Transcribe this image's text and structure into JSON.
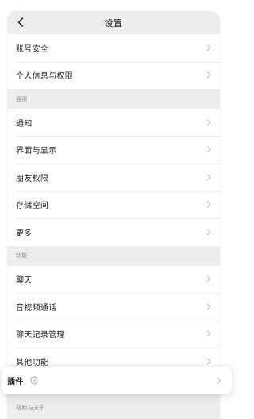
{
  "header": {
    "title": "设置",
    "back_icon": "chevron-left-icon"
  },
  "account_group": {
    "items": [
      {
        "label": "账号安全"
      },
      {
        "label": "个人信息与权限"
      }
    ]
  },
  "general_group": {
    "heading": "通用",
    "items": [
      {
        "label": "通知"
      },
      {
        "label": "界面与显示"
      },
      {
        "label": "朋友权限"
      },
      {
        "label": "存储空间"
      },
      {
        "label": "更多"
      }
    ]
  },
  "features_group": {
    "heading": "功能",
    "items": [
      {
        "label": "聊天"
      },
      {
        "label": "音视频通话"
      },
      {
        "label": "聊天记录管理"
      },
      {
        "label": "其他功能"
      }
    ]
  },
  "plugins_card": {
    "label": "插件",
    "badge_icon": "shield-icon"
  },
  "help_group": {
    "heading": "帮助与关于"
  },
  "colors": {
    "background": "#ededed",
    "card": "#ffffff",
    "text": "#1a1a1a",
    "muted": "#8a8a8a",
    "chevron": "#b2b2b2"
  }
}
